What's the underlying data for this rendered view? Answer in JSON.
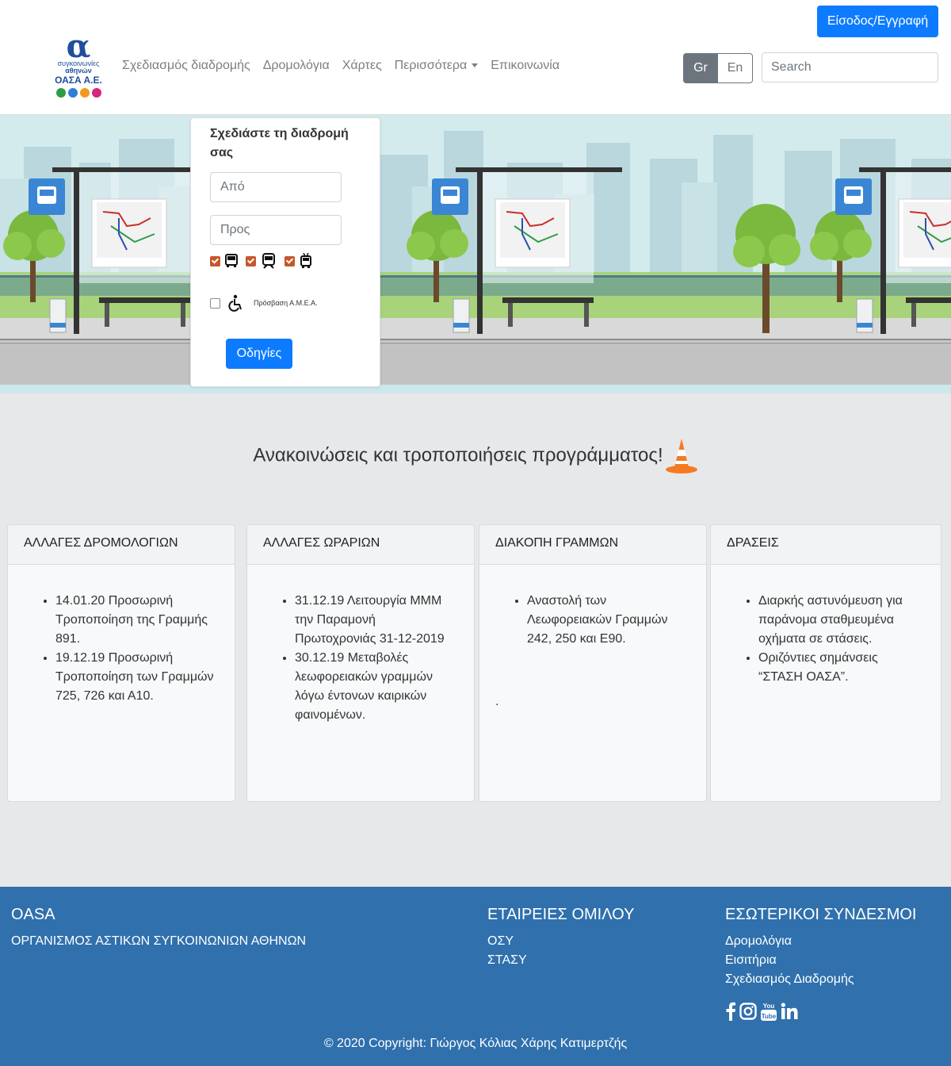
{
  "header": {
    "login_label": "Είσοδος/Εγγραφή",
    "logo": {
      "line1": "συγκοινωνίες",
      "line2": "αθηνών",
      "line3": "ΟΑΣΑ Α.Ε."
    },
    "nav": {
      "route_planning": "Σχεδιασμός διαδρομής",
      "schedules": "Δρομολόγια",
      "maps": "Χάρτες",
      "more": "Περισσότερα",
      "contact": "Επικοινωνία"
    },
    "lang": {
      "gr": "Gr",
      "en": "En",
      "active": "Gr"
    },
    "search_placeholder": "Search"
  },
  "route_planner": {
    "title": "Σχεδιάστε τη διαδρομή σας",
    "from_placeholder": "Από",
    "to_placeholder": "Προς",
    "modes": [
      {
        "icon": "bus-icon",
        "checked": true
      },
      {
        "icon": "metro-icon",
        "checked": true
      },
      {
        "icon": "trolley-icon",
        "checked": true
      }
    ],
    "accessibility_label": "Πρόσβαση Α.Μ.Ε.Α.",
    "accessibility_checked": false,
    "directions_label": "Οδηγίες"
  },
  "announcements": {
    "title": "Ανακοινώσεις και τροποποιήσεις προγράμματος!",
    "cards": [
      {
        "header": "ΑΛΛΑΓΕΣ ΔΡΟΜΟΛΟΓΙΩΝ",
        "items": [
          "14.01.20 Προσωρινή Τροποποίηση της Γραμμής 891.",
          "19.12.19 Προσωρινή Τροποποίηση των Γραμμών 725, 726 και Α10."
        ]
      },
      {
        "header": "ΑΛΛΑΓΕΣ ΩΡΑΡΙΩΝ",
        "items": [
          "31.12.19 Λειτουργία ΜΜΜ την Παραμονή Πρωτοχρονιάς 31-12-2019",
          "30.12.19 Μεταβολές λεωφορειακών γραμμών λόγω έντονων καιρικών φαινομένων."
        ]
      },
      {
        "header": "ΔΙΑΚΟΠΗ ΓΡΑΜΜΩΝ",
        "items": [
          "Αναστολή των Λεωφορειακών Γραμμών 242, 250 και Ε90."
        ],
        "extra": "."
      },
      {
        "header": "ΔΡΑΣΕΙΣ",
        "items": [
          "Διαρκής αστυνόμευση για παράνομα σταθμευμένα οχήματα σε στάσεις.",
          "Οριζόντιες σημάνσεις “ΣΤΑΣΗ ΟΑΣΑ”."
        ]
      }
    ]
  },
  "footer": {
    "brand_title": "OASA",
    "brand_subtitle": "ΟΡΓΑΝΙΣΜΟΣ ΑΣΤΙΚΩΝ ΣΥΓΚΟΙΝΩΝΙΩΝ ΑΘΗΝΩΝ",
    "group_title": "ΕΤΑΙΡΕΙΕΣ ΟΜΙΛΟΥ",
    "group_links": [
      "ΟΣΥ",
      "ΣΤΑΣΥ"
    ],
    "internal_title": "ΕΣΩΤΕΡΙΚΟΙ ΣΥΝΔΕΣΜΟΙ",
    "internal_links": [
      "Δρομολόγια",
      "Εισιτήρια",
      "Σχεδιασμός Διαδρομής"
    ],
    "socials": [
      "facebook-icon",
      "instagram-icon",
      "youtube-icon",
      "linkedin-icon"
    ],
    "youtube_text": "You Tube",
    "copyright": "© 2020 Copyright: Γιώργος Κόλιας Χάρης Κατιμερτζής"
  },
  "colors": {
    "primary": "#0d7bff",
    "footer": "#2f70ad",
    "checkbox": "#c8562b"
  }
}
